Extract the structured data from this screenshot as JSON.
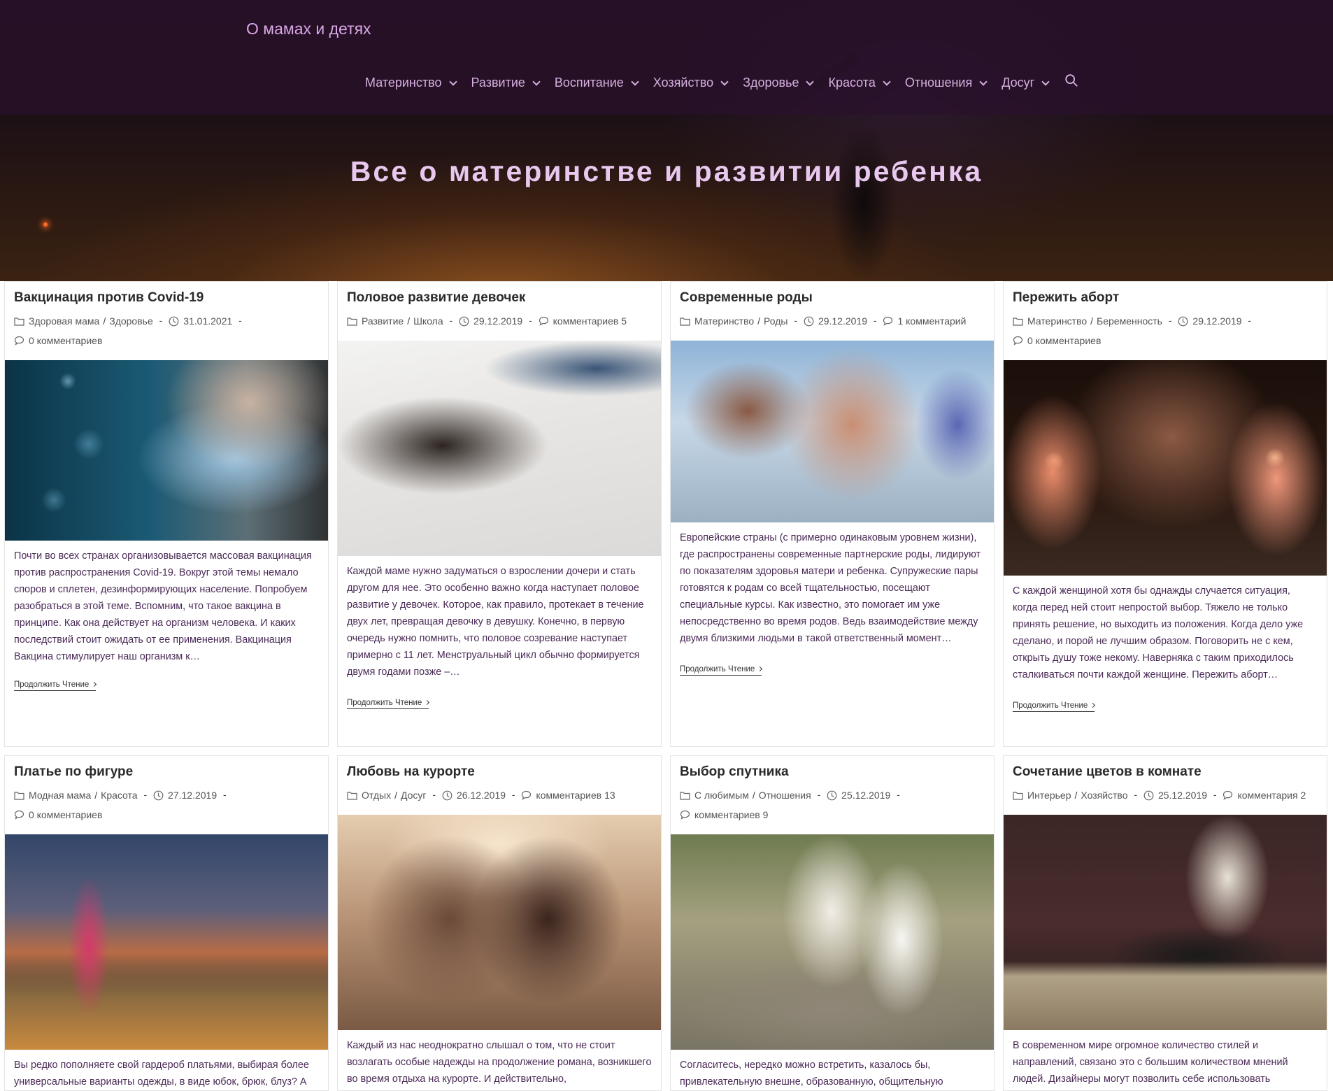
{
  "site": {
    "title": "О мамах и детях",
    "hero_title": "Все о материнстве и развитии ребенка"
  },
  "nav": {
    "items": [
      {
        "label": "Материнство"
      },
      {
        "label": "Развитие"
      },
      {
        "label": "Воспитание"
      },
      {
        "label": "Хозяйство"
      },
      {
        "label": "Здоровье"
      },
      {
        "label": "Красота"
      },
      {
        "label": "Отношения"
      },
      {
        "label": "Досуг"
      }
    ],
    "search_icon": "search-icon"
  },
  "colors": {
    "accent": "#d7b0e0",
    "excerpt_text": "#4b2b57"
  },
  "read_more_label": "Продолжить Чтение",
  "posts": [
    {
      "title": "Вакцинация против Covid-19",
      "cat1": "Здоровая мама",
      "cat2": "Здоровье",
      "date": "31.01.2021",
      "comments": "0 комментариев",
      "excerpt": "Почти во всех странах организовывается массовая вакцинация против распространения Covid-19. Вокруг этой темы немало споров и сплетен, дезинформирующих население. Попробуем разобраться в этой теме. Вспомним, что такое вакцина в принципе. Как она действует на организм человека. И каких последствий стоит ожидать от ее применения. Вакцинация Вакцина стимулирует наш организм к…"
    },
    {
      "title": "Половое развитие девочек",
      "cat1": "Развитие",
      "cat2": "Школа",
      "date": "29.12.2019",
      "comments": "комментариев 5",
      "excerpt": "Каждой маме нужно задуматься о взрослении дочери и стать другом для нее. Это особенно важно когда наступает половое развитие у девочек. Которое, как правило, протекает в течение двух лет, превращая девочку в девушку. Конечно, в первую очередь нужно помнить, что половое созревание наступает примерно с 11 лет. Менструальный цикл обычно формируется двумя годами позже –…"
    },
    {
      "title": "Современные роды",
      "cat1": "Материнство",
      "cat2": "Роды",
      "date": "29.12.2019",
      "comments": "1 комментарий",
      "excerpt": "Европейские страны (с примерно одинаковым уровнем жизни), где распространены современные партнерские роды, лидируют по показателям здоровья матери и ребенка. Супружеские пары готовятся к родам со всей тщательностью, посещают специальные курсы. Как известно, это помогает им уже непосредственно во время родов. Ведь взаимодействие между двумя близкими людьми в такой ответственный момент…"
    },
    {
      "title": "Пережить аборт",
      "cat1": "Материнство",
      "cat2": "Беременность",
      "date": "29.12.2019",
      "comments": "0 комментариев",
      "excerpt": "С каждой женщиной хотя бы однажды случается ситуация, когда перед ней стоит непростой выбор. Тяжело не только принять решение, но выходить из  положения. Когда дело уже сделано, и порой не лучшим образом. Поговорить не с кем, открыть душу тоже некому. Наверняка с таким приходилось сталкиваться почти каждой женщине. Пережить аборт…"
    },
    {
      "title": "Платье по фигуре",
      "cat1": "Модная мама",
      "cat2": "Красота",
      "date": "27.12.2019",
      "comments": "0 комментариев",
      "excerpt": "Вы редко пополняете свой гардероб платьями, выбирая более универсальные варианты одежды, в виде юбок, брюк, блуз? А зря, правильно подобранное платье по фигуре"
    },
    {
      "title": "Любовь на курорте",
      "cat1": "Отдых",
      "cat2": "Досуг",
      "date": "26.12.2019",
      "comments": "комментариев 13",
      "excerpt": "Каждый из нас неоднократно слышал о том, что не стоит возлагать особые надежды на продолжение романа, возникшего во время отдыха на курорте. И действительно,"
    },
    {
      "title": "Выбор спутника",
      "cat1": "С любимым",
      "cat2": "Отношения",
      "date": "25.12.2019",
      "comments": "комментариев 9",
      "excerpt": "Согласитесь, нередко можно встретить, казалось бы, привлекательную внешне, образованную, общительную"
    },
    {
      "title": "Сочетание цветов в комнате",
      "cat1": "Интерьер",
      "cat2": "Хозяйство",
      "date": "25.12.2019",
      "comments": "комментария 2",
      "excerpt": "В современном мире огромное количество стилей и направлений, связано это с большим количеством мнений людей. Дизайнеры могут позволить себе использовать"
    }
  ]
}
